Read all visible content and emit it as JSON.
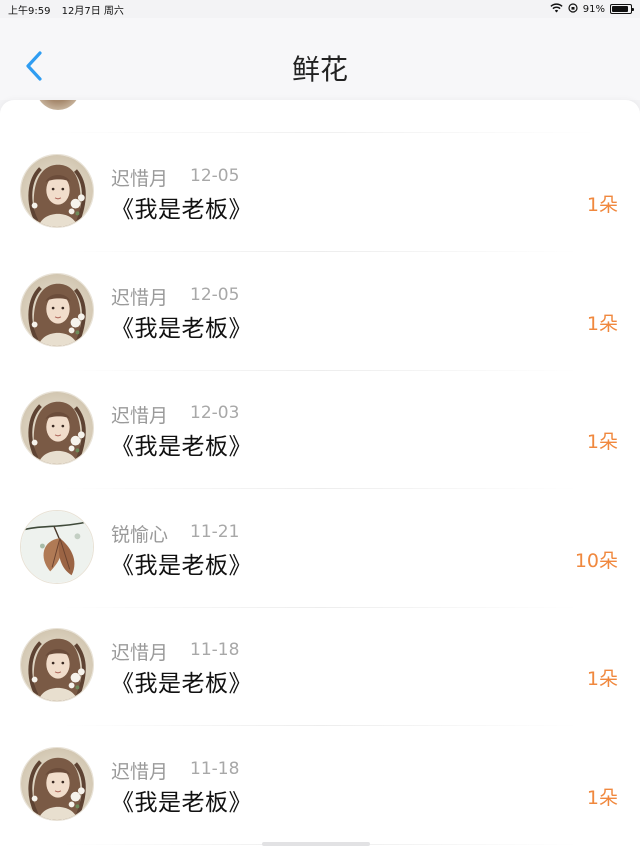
{
  "status_bar": {
    "time": "上午9:59",
    "date": "12月7日 周六",
    "battery_percent": "91%",
    "battery_level": 0.91
  },
  "nav": {
    "title": "鲜花"
  },
  "colors": {
    "accent_blue": "#2f9df2",
    "count_orange": "#f0883e"
  },
  "rows": [
    {
      "name": "迟惜月",
      "date": "12-05",
      "title": "《我是老板》",
      "count": "1朵",
      "avatar": "portrait-avatar"
    },
    {
      "name": "迟惜月",
      "date": "12-05",
      "title": "《我是老板》",
      "count": "1朵",
      "avatar": "portrait-avatar"
    },
    {
      "name": "迟惜月",
      "date": "12-03",
      "title": "《我是老板》",
      "count": "1朵",
      "avatar": "portrait-avatar"
    },
    {
      "name": "锐愉心",
      "date": "11-21",
      "title": "《我是老板》",
      "count": "10朵",
      "avatar": "leaf-avatar"
    },
    {
      "name": "迟惜月",
      "date": "11-18",
      "title": "《我是老板》",
      "count": "1朵",
      "avatar": "portrait-avatar"
    },
    {
      "name": "迟惜月",
      "date": "11-18",
      "title": "《我是老板》",
      "count": "1朵",
      "avatar": "portrait-avatar"
    }
  ]
}
